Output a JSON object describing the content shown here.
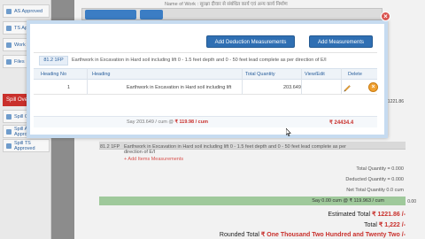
{
  "header": {
    "name_of_work": "Name of Work : सुरक्षा दीवार से संबंधित कार्य एवं अन्य कार्य निर्माण"
  },
  "sidebar": {
    "items": [
      {
        "label": "AS Approved"
      },
      {
        "label": "TS Approved"
      },
      {
        "label": "Work Initiated"
      },
      {
        "label": "Files"
      },
      {
        "label": "Spill Over"
      },
      {
        "label": "Spill Over"
      },
      {
        "label": "Spill AS Approved"
      },
      {
        "label": "Spill TS Approved"
      }
    ],
    "section_label": "Spill Over"
  },
  "modal": {
    "add_deduction_label": "Add Deduction Measurements",
    "add_measurements_label": "Add Measurements",
    "item_code": "81.2 1FP",
    "item_description": "Earthwork in Excavation in Hard soil including lift 0 - 1.5 feet depth and 0 - 50 feet lead complete as per direction of E/I",
    "columns": [
      "Heading No",
      "Heading",
      "Total Quantity",
      "View/Edit",
      "Delete"
    ],
    "rows": [
      {
        "heading_no": "1",
        "heading": "Earthwork in Excavation in Hard soil including lift",
        "total_quantity": "203.649"
      }
    ],
    "footer_text": "Say 203.649 / cum @",
    "footer_rate": "₹ 119.98 / cum",
    "footer_amount": "₹ 24434.4"
  },
  "background": {
    "item_code": "81.2 1FP",
    "item_description": "Earthwork in Excavation in Hard soil including lift 0 - 1.5 feet depth and 0 - 50 feet lead complete as per",
    "item_description_2": "direction of E/I",
    "add_link": "+ Add Items Measurements",
    "total_quantity": "Total Quantity = 0.000",
    "deducted_quantity": "Deducted Quantity = 0.000",
    "net_total_quantity": "Net Total Quantity 0.0 cum",
    "summary": "Say 0.00 cum @ ₹ 119.963 / cum",
    "summary_value": "0.00",
    "estimated_total_label": "Estimated Total",
    "estimated_total_value": "₹ 1221.86 /-",
    "total_label": "Total",
    "total_value": "₹ 1,222 /-",
    "rounded_total_label": "Rounded Total",
    "rounded_total_value": "₹ One Thousand Two Hundred and Twenty Two /-",
    "side_amount": "1221.86"
  },
  "colors": {
    "primary_button": "#2f6fb3",
    "danger": "#c9302c",
    "modal_border": "#c6dbf0"
  }
}
